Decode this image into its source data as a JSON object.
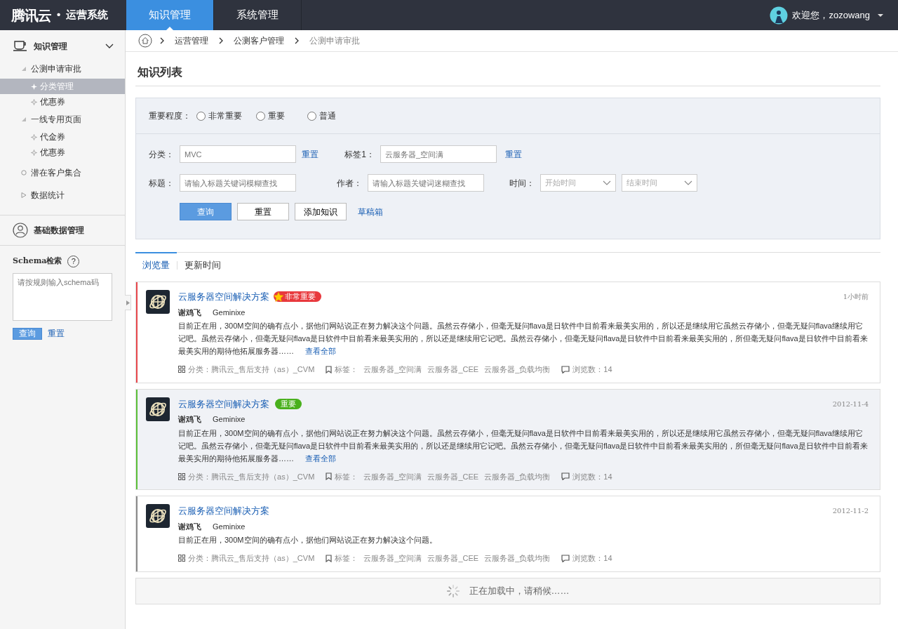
{
  "brand": {
    "logo": "腾讯云",
    "separator": "•",
    "name": "运营系统"
  },
  "top_nav": [
    {
      "label": "知识管理",
      "selected": true
    },
    {
      "label": "系统管理",
      "selected": false
    }
  ],
  "user": {
    "greeting": "欢迎您，zozowang"
  },
  "sidebar": {
    "sections": [
      {
        "title": "知识管理",
        "kind": "cup",
        "expanded": true,
        "items": [
          {
            "label": "公测申请审批",
            "kind": "group",
            "expanded": true,
            "children": [
              {
                "label": "分类管理",
                "selected": true
              },
              {
                "label": "优惠券",
                "selected": false
              }
            ]
          },
          {
            "label": "一线专用页面",
            "kind": "group",
            "expanded": true,
            "children": [
              {
                "label": "代金券",
                "selected": false
              },
              {
                "label": "优惠券",
                "selected": false
              }
            ]
          },
          {
            "label": "潜在客户集合",
            "kind": "link"
          },
          {
            "label": "数据统计",
            "kind": "group",
            "expanded": false
          }
        ]
      },
      {
        "title": "基础数据管理",
        "kind": "person"
      }
    ],
    "schema": {
      "label": "Schema检索",
      "help": "?",
      "placeholder": "请按规则输入schema码",
      "query": "查询",
      "reset": "重置"
    }
  },
  "breadcrumb": [
    "运营管理",
    "公测客户管理",
    "公测申请审批"
  ],
  "page_title": "知识列表",
  "filter": {
    "importance": {
      "label": "重要程度：",
      "options": [
        {
          "label": "非常重要",
          "selected": false
        },
        {
          "label": "重要",
          "selected": false
        },
        {
          "label": "普通",
          "selected": false
        }
      ]
    },
    "category": {
      "label": "分类：",
      "placeholder": "MVC",
      "reset": "重置"
    },
    "tag": {
      "label": "标签1：",
      "placeholder": "云服务器_空间满",
      "reset": "重置"
    },
    "title": {
      "label": "标题：",
      "placeholder": "请输入标题关键词模糊查找"
    },
    "author": {
      "label": "作者：",
      "placeholder": "请输入标题关键词迷糊查找"
    },
    "time": {
      "label": "时间：",
      "start_placeholder": "开始时间",
      "end_placeholder": "结束时间"
    },
    "buttons": [
      {
        "label": "查询",
        "kind": "primary"
      },
      {
        "label": "重置",
        "kind": "default"
      },
      {
        "label": "添加知识",
        "kind": "default"
      },
      {
        "label": "草稿箱",
        "kind": "link"
      }
    ]
  },
  "sort_tabs": [
    {
      "label": "浏览量",
      "selected": true
    },
    {
      "label": "更新时间",
      "selected": false
    }
  ],
  "articles": [
    {
      "title": "云服务器空间解决方案",
      "badge": {
        "label": "非常重要",
        "color": "#e8383d",
        "starred": true
      },
      "time": "1小时前",
      "author": "谢鸡飞",
      "alias": "Geminixe",
      "color": "#e8474c",
      "highlighted": false,
      "body": "目前正在用，300M空间的确有点小，据他们网站说正在努力解决这个问题。虽然云存储小，但毫无疑问flava是日软件中目前看来最美实用的，所以还是继续用它虽然云存储小，但毫无疑问flava继续用它记吧。虽然云存储小，但毫无疑问flava是日软件中目前看来最美实用的，所以还是继续用它记吧。虽然云存储小，但毫无疑问flava是日软件中目前看来最美实用的，所但毫无疑问flava是日软件中目前看来最美实用的期待他拓展服务器……",
      "more": "查看全部",
      "category": "分类：腾讯云_售后支持（as）_CVM",
      "tags_label": "标签：",
      "tags": [
        "云服务器_空间满",
        "云服务器_CEE",
        "云服务器_负载均衡"
      ],
      "views": "浏览数：14"
    },
    {
      "title": "云服务器空间解决方案",
      "badge": {
        "label": "重要",
        "color": "#49b01c",
        "starred": false
      },
      "time": "2012-11-4",
      "author": "谢鸡飞",
      "alias": "Geminixe",
      "color": "#5cc03a",
      "highlighted": true,
      "body": "目前正在用，300M空间的确有点小，据他们网站说正在努力解决这个问题。虽然云存储小，但毫无疑问flava是日软件中目前看来最美实用的，所以还是继续用它虽然云存储小，但毫无疑问flava继续用它记吧。虽然云存储小，但毫无疑问flava是日软件中目前看来最美实用的，所以还是继续用它记吧。虽然云存储小，但毫无疑问flava是日软件中目前看来最美实用的，所但毫无疑问flava是日软件中目前看来最美实用的期待他拓展服务器……",
      "more": "查看全部",
      "category": "分类：腾讯云_售后支持（as）_CVM",
      "tags_label": "标签：",
      "tags": [
        "云服务器_空间满",
        "云服务器_CEE",
        "云服务器_负载均衡"
      ],
      "views": "浏览数：14"
    },
    {
      "title": "云服务器空间解决方案",
      "time": "2012-11-2",
      "author": "谢鸡飞",
      "alias": "Geminixe",
      "color": "#8a8a8a",
      "highlighted": false,
      "body": "目前正在用，300M空间的确有点小，据他们网站说正在努力解决这个问题。",
      "category": "分类：腾讯云_售后支持（as）_CVM",
      "tags_label": "标签：",
      "tags": [
        "云服务器_空间满",
        "云服务器_CEE",
        "云服务器_负载均衡"
      ],
      "views": "浏览数：14"
    }
  ],
  "loading": {
    "text": "正在加载中，请稍候……"
  }
}
